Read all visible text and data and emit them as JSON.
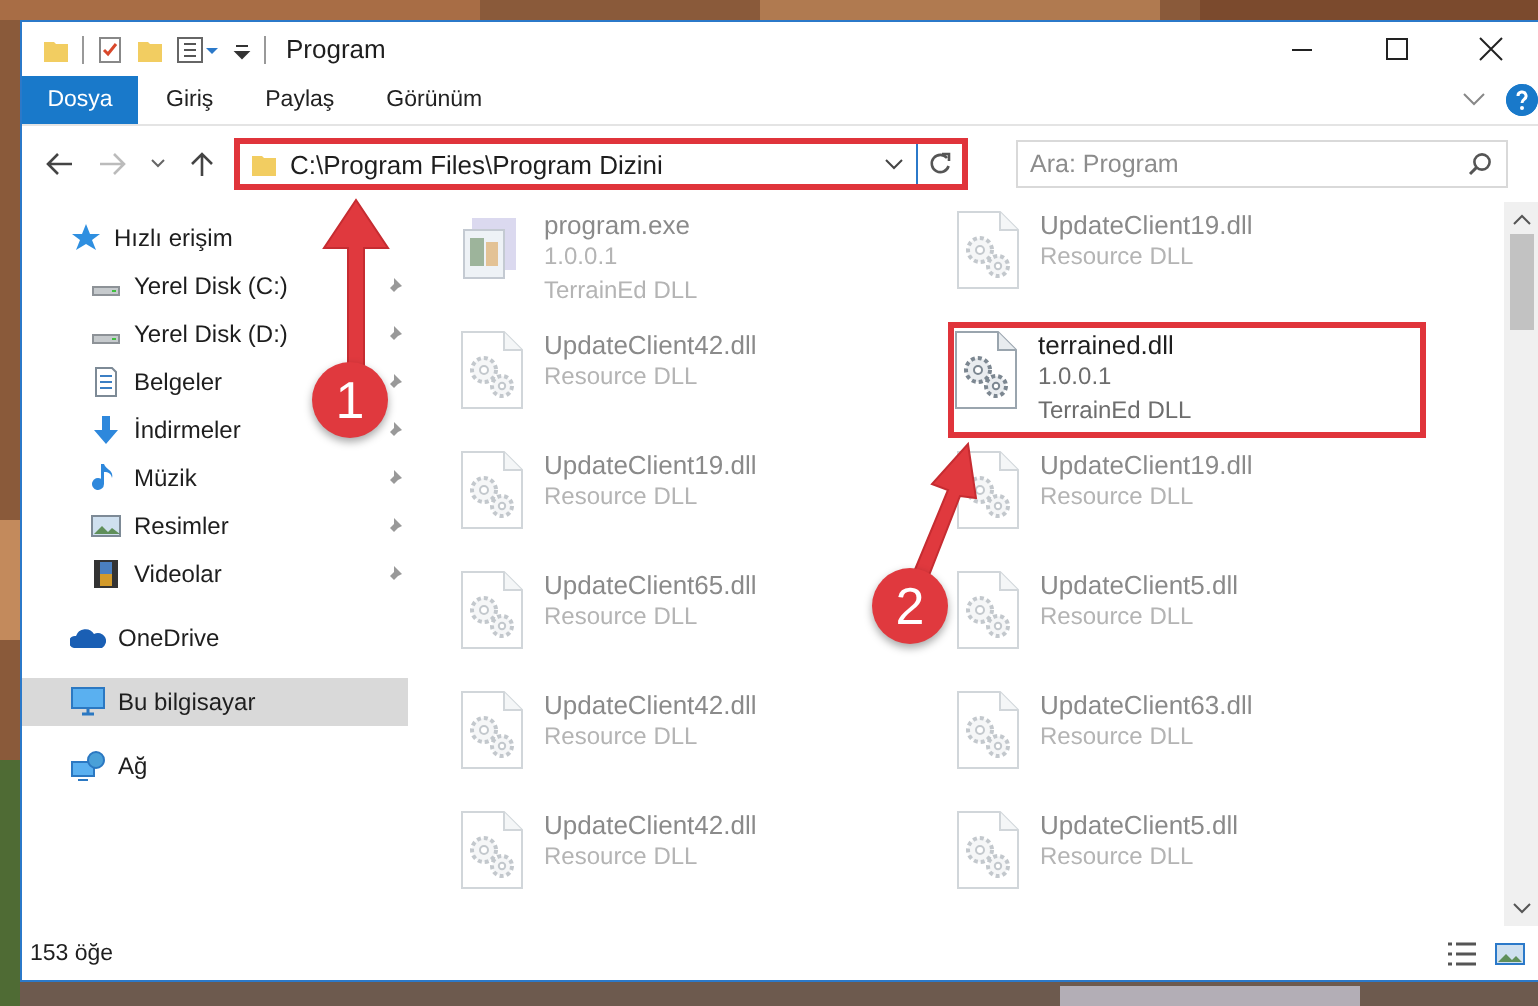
{
  "window": {
    "title": "Program"
  },
  "ribbon_tabs": [
    {
      "label": "Dosya",
      "kind": "file"
    },
    {
      "label": "Giriş",
      "kind": "tab"
    },
    {
      "label": "Paylaş",
      "kind": "tab"
    },
    {
      "label": "Görünüm",
      "kind": "tab"
    }
  ],
  "address_bar": {
    "path": "C:\\Program Files\\Program Dizini",
    "highlighted": true
  },
  "search": {
    "placeholder": "Ara: Program"
  },
  "sidebar": {
    "items": [
      {
        "label": "Hızlı erişim",
        "kind": "star",
        "selected": false,
        "children": [
          {
            "label": "Yerel Disk (C:)",
            "kind": "drive",
            "pinned": true
          },
          {
            "label": "Yerel Disk (D:)",
            "kind": "drive",
            "pinned": true
          },
          {
            "label": "Belgeler",
            "kind": "document",
            "pinned": true
          },
          {
            "label": "İndirmeler",
            "kind": "download",
            "pinned": true
          },
          {
            "label": "Müzik",
            "kind": "music",
            "pinned": true
          },
          {
            "label": "Resimler",
            "kind": "pictures",
            "pinned": true
          },
          {
            "label": "Videolar",
            "kind": "video",
            "pinned": true
          }
        ]
      },
      {
        "label": "OneDrive",
        "kind": "cloud",
        "selected": false
      },
      {
        "label": "Bu bilgisayar",
        "kind": "computer",
        "selected": true
      },
      {
        "label": "Ağ",
        "kind": "network",
        "selected": false
      }
    ]
  },
  "files": [
    {
      "name": "program.exe",
      "details": [
        "1.0.0.1",
        "TerrainEd DLL"
      ],
      "kind": "exe",
      "blurred": true,
      "highlighted": false
    },
    {
      "name": "UpdateClient19.dll",
      "details": [
        "Resource DLL"
      ],
      "kind": "dll",
      "blurred": true,
      "highlighted": false
    },
    {
      "name": "UpdateClient42.dll",
      "details": [
        "Resource DLL"
      ],
      "kind": "dll",
      "blurred": true,
      "highlighted": false
    },
    {
      "name": "terrained.dll",
      "details": [
        "1.0.0.1",
        "TerrainEd DLL"
      ],
      "kind": "dll",
      "blurred": false,
      "highlighted": true
    },
    {
      "name": "UpdateClient19.dll",
      "details": [
        "Resource DLL"
      ],
      "kind": "dll",
      "blurred": true,
      "highlighted": false
    },
    {
      "name": "UpdateClient19.dll",
      "details": [
        "Resource DLL"
      ],
      "kind": "dll",
      "blurred": true,
      "highlighted": false
    },
    {
      "name": "UpdateClient65.dll",
      "details": [
        "Resource DLL"
      ],
      "kind": "dll",
      "blurred": true,
      "highlighted": false
    },
    {
      "name": "UpdateClient5.dll",
      "details": [
        "Resource DLL"
      ],
      "kind": "dll",
      "blurred": true,
      "highlighted": false
    },
    {
      "name": "UpdateClient42.dll",
      "details": [
        "Resource DLL"
      ],
      "kind": "dll",
      "blurred": true,
      "highlighted": false
    },
    {
      "name": "UpdateClient63.dll",
      "details": [
        "Resource DLL"
      ],
      "kind": "dll",
      "blurred": true,
      "highlighted": false
    },
    {
      "name": "UpdateClient42.dll",
      "details": [
        "Resource DLL"
      ],
      "kind": "dll",
      "blurred": true,
      "highlighted": false
    },
    {
      "name": "UpdateClient5.dll",
      "details": [
        "Resource DLL"
      ],
      "kind": "dll",
      "blurred": true,
      "highlighted": false
    }
  ],
  "status_bar": {
    "item_count": "153 öğe"
  },
  "annotations": [
    {
      "number": "1"
    },
    {
      "number": "2"
    }
  ]
}
